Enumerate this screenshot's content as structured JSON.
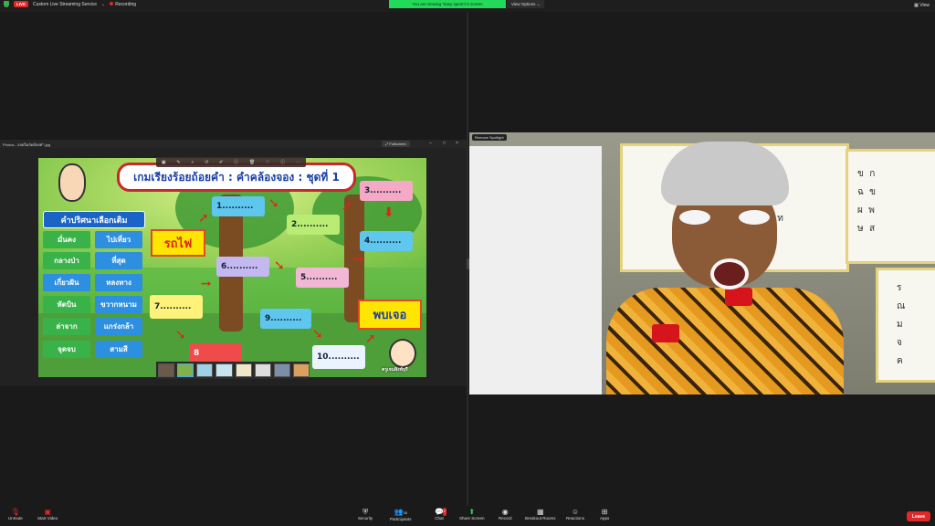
{
  "topbar": {
    "live_badge": "LIVE",
    "stream_service": "Custom Live Streaming Service",
    "recording": "Recording",
    "viewing_banner": "You are viewing ‘Sasy spent’s’s screen",
    "view_options": "View Options",
    "view": "View"
  },
  "viewer": {
    "window_title": "Photos - ลอยล็มลัดต้อยคำ.jpg",
    "fullscreen": "Fullscreen",
    "toolbar_icons": [
      "crop-icon",
      "edit-icon",
      "zoom-icon",
      "rotate-icon",
      "draw-icon",
      "info-icon",
      "delete-icon",
      "heart-icon",
      "info-icon",
      "more-icon"
    ]
  },
  "slide": {
    "title": "เกมเรียงร้อยถ้อยคำ : คำคล้องจอง : ชุดที่ 1",
    "words_header": "คำปริศนาเลือกเติม",
    "words_left": [
      "มั่นคง",
      "กลางป่า",
      "เกี่ยวฝัน",
      "หัดบิน",
      "ล่าจาก",
      "จุดจบ"
    ],
    "words_right": [
      "ไปเที่ยว",
      "ที่สุด",
      "หลงทาง",
      "ขวากหนาม",
      "แกร่งกล้า",
      "สามสี"
    ],
    "start_word": "รถไฟ",
    "end_word": "พบเจอ",
    "slots": [
      "1..........",
      "2..........",
      "3..........",
      "4..........",
      "5..........",
      "6..........",
      "7..........",
      "8",
      "9..........",
      "10.........."
    ],
    "author": "ครูเจนสิงห์บุรี"
  },
  "video": {
    "spotlight_label": "Remove Spotlight"
  },
  "toolbar": {
    "unmute": "Unmute",
    "start_video": "Start Video",
    "security": "Security",
    "participants": "Participants",
    "participants_count": "35",
    "chat": "Chat",
    "chat_badge": "2",
    "share_screen": "Share Screen",
    "record": "Record",
    "breakout_rooms": "Breakout Rooms",
    "reactions": "Reactions",
    "apps": "Apps",
    "leave": "Leave"
  },
  "colors": {
    "live_red": "#e02828",
    "share_green": "#23d959",
    "leave_red": "#e02828"
  }
}
